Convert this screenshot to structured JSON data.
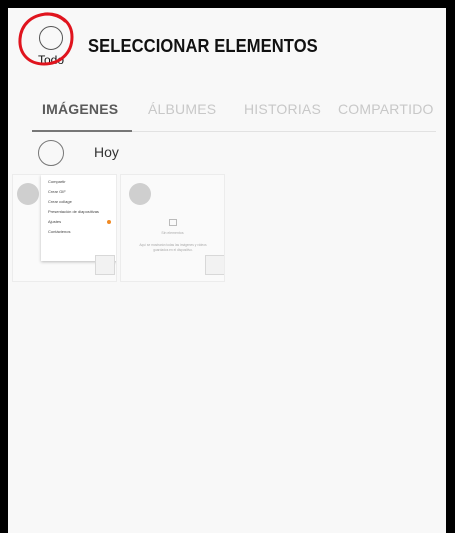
{
  "header": {
    "select_all_label": "Todo",
    "title": "SELECCIONAR ELEMENTOS"
  },
  "tabs": [
    {
      "label": "IMÁGENES",
      "active": true
    },
    {
      "label": "ÁLBUMES",
      "active": false
    },
    {
      "label": "HISTORIAS",
      "active": false
    },
    {
      "label": "COMPARTIDO",
      "active": false
    }
  ],
  "group": {
    "label": "Hoy"
  },
  "thumb1": {
    "menu_items": [
      "Compartir",
      "Crear GIF",
      "Crear collage",
      "Presentación de diapositivas",
      "Ajustes",
      "Contáctenos"
    ]
  },
  "thumb2": {
    "empty_title": "Sin elementos",
    "empty_text": "Aquí se mostrarán todas las imágenes y vídeos guardados en el dispositivo."
  },
  "colors": {
    "annotation_ring": "#e0141e",
    "badge_dot": "#f08a24",
    "active_tab": "#5a5a5a",
    "inactive_tab": "#c8c8c8"
  }
}
